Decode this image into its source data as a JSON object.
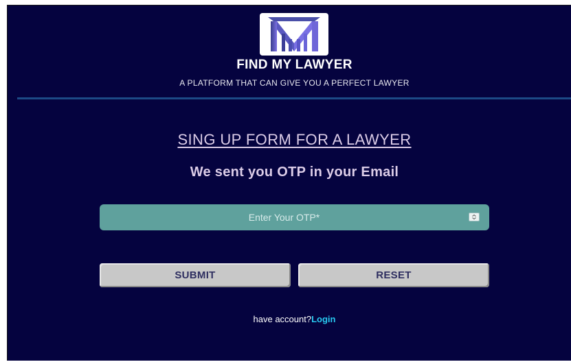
{
  "header": {
    "brand_name": "FIND MY LAWYER",
    "tagline": "A PLATFORM THAT CAN GIVE YOU A PERFECT LAWYER",
    "logo_icon": "law-firm-logo-icon"
  },
  "form": {
    "title": "SING UP FORM FOR A LAWYER",
    "otp_message": "We sent you OTP in your Email",
    "otp_input": {
      "placeholder": "Enter Your OTP*",
      "value": ""
    },
    "submit_label": "SUBMIT",
    "reset_label": "RESET"
  },
  "footer": {
    "have_account_text": "have account?",
    "login_link": "Login"
  },
  "colors": {
    "background": "#05033f",
    "divider": "#1c4a86",
    "input_bg": "#5fa19d",
    "button_bg": "#c8c8c8",
    "link": "#28c9f0",
    "title_text": "#dccde8"
  }
}
